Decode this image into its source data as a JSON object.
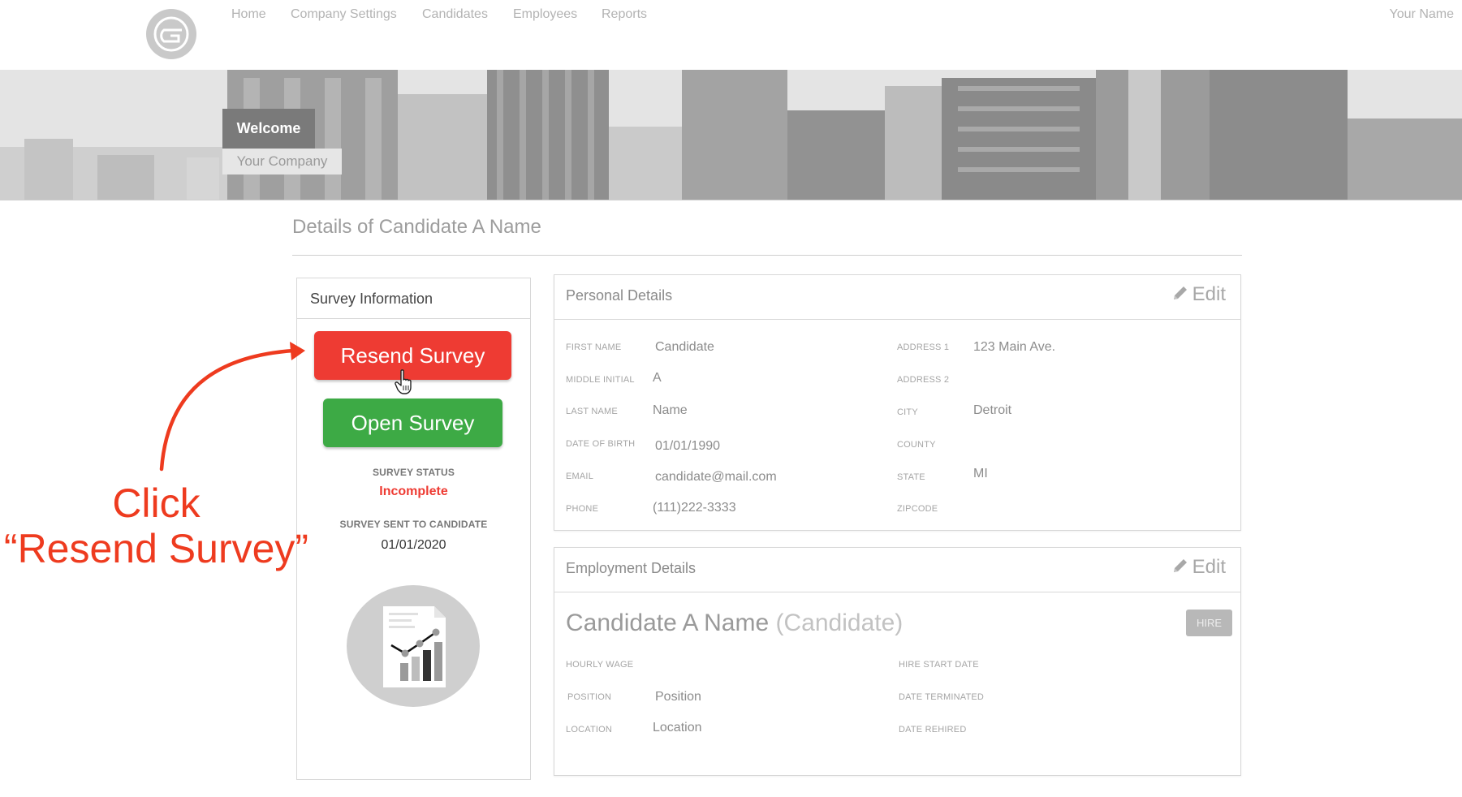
{
  "nav": {
    "items": [
      "Home",
      "Company Settings",
      "Candidates",
      "Employees",
      "Reports"
    ],
    "user_name": "Your Name"
  },
  "banner": {
    "welcome": "Welcome",
    "company": "Your Company"
  },
  "page": {
    "title": "Details of Candidate A Name"
  },
  "survey": {
    "header": "Survey Information",
    "resend_label": "Resend Survey",
    "open_label": "Open Survey",
    "status_label": "SURVEY STATUS",
    "status_value": "Incomplete",
    "sent_label": "SURVEY SENT TO CANDIDATE",
    "sent_value": "01/01/2020",
    "colors": {
      "resend": "#ee3b33",
      "open": "#3daa45"
    }
  },
  "annotation": {
    "line1": "Click",
    "line2": "“Resend Survey”",
    "color": "#ee3b1f"
  },
  "personal": {
    "title": "Personal Details",
    "edit_label": "Edit",
    "left_fields": [
      {
        "label": "FIRST NAME",
        "value": "Candidate"
      },
      {
        "label": "MIDDLE INITIAL",
        "value": "A"
      },
      {
        "label": "LAST NAME",
        "value": "Name"
      },
      {
        "label": "DATE OF BIRTH",
        "value": "01/01/1990"
      },
      {
        "label": "EMAIL",
        "value": "candidate@mail.com"
      },
      {
        "label": "PHONE",
        "value": "(111)222-3333"
      }
    ],
    "right_fields": [
      {
        "label": "ADDRESS 1",
        "value": "123 Main Ave."
      },
      {
        "label": "ADDRESS 2",
        "value": ""
      },
      {
        "label": "CITY",
        "value": "Detroit"
      },
      {
        "label": "COUNTY",
        "value": ""
      },
      {
        "label": "STATE",
        "value": "MI"
      },
      {
        "label": "ZIPCODE",
        "value": ""
      }
    ]
  },
  "employment": {
    "title": "Employment Details",
    "edit_label": "Edit",
    "name": "Candidate A Name",
    "role": "(Candidate)",
    "hire_label": "HIRE",
    "left_fields": [
      {
        "label": "HOURLY WAGE",
        "value": ""
      },
      {
        "label": "POSITION",
        "value": "Position"
      },
      {
        "label": "LOCATION",
        "value": "Location"
      }
    ],
    "right_fields": [
      {
        "label": "HIRE START DATE",
        "value": ""
      },
      {
        "label": "DATE TERMINATED",
        "value": ""
      },
      {
        "label": "DATE REHIRED",
        "value": ""
      }
    ]
  }
}
